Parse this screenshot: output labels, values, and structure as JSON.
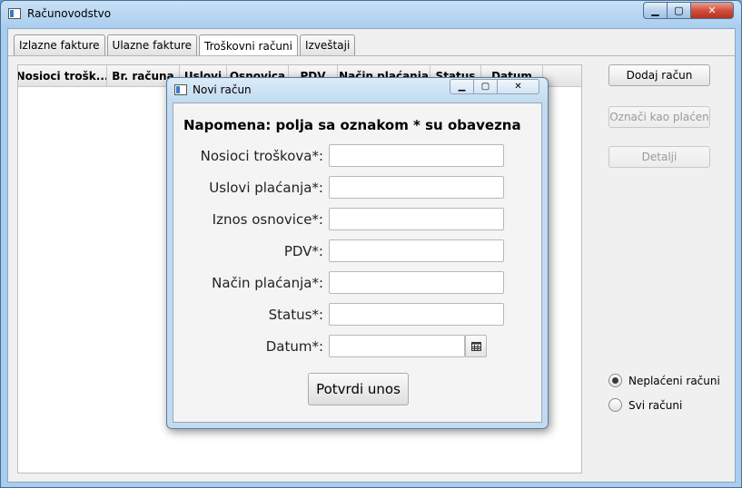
{
  "window": {
    "title": "Računovodstvo",
    "controls": {
      "minimize": "▁",
      "maximize": "▢",
      "close": "✕"
    }
  },
  "tabs": [
    {
      "label": "Izlazne fakture",
      "active": false
    },
    {
      "label": "Ulazne fakture",
      "active": false
    },
    {
      "label": "Troškovni računi",
      "active": true
    },
    {
      "label": "Izveštaji",
      "active": false
    }
  ],
  "table": {
    "columns": [
      "Nosioci trošk...",
      "Br. računa",
      "Uslovi",
      "Osnovica",
      "PDV",
      "Način plaćanja",
      "Status",
      "Datum"
    ]
  },
  "sidebar": {
    "add_button": "Dodaj račun",
    "mark_paid_button": "Označi kao plaćen",
    "details_button": "Detalji",
    "radio_unpaid": "Neplaćeni računi",
    "radio_all": "Svi računi"
  },
  "dialog": {
    "title": "Novi račun",
    "note": "Napomena: polja sa oznakom * su obavezna",
    "fields": [
      {
        "label": "Nosioci troškova*:",
        "value": ""
      },
      {
        "label": "Uslovi plaćanja*:",
        "value": ""
      },
      {
        "label": "Iznos osnovice*:",
        "value": ""
      },
      {
        "label": "PDV*:",
        "value": ""
      },
      {
        "label": "Način plaćanja*:",
        "value": ""
      },
      {
        "label": "Status*:",
        "value": ""
      }
    ],
    "date_label": "Datum*:",
    "date_value": "",
    "submit_label": "Potvrdi unos",
    "controls": {
      "minimize": "▁",
      "maximize": "▢",
      "close": "✕"
    }
  },
  "icons": {
    "app": "window-app-icon",
    "calendar": "calendar-icon"
  }
}
